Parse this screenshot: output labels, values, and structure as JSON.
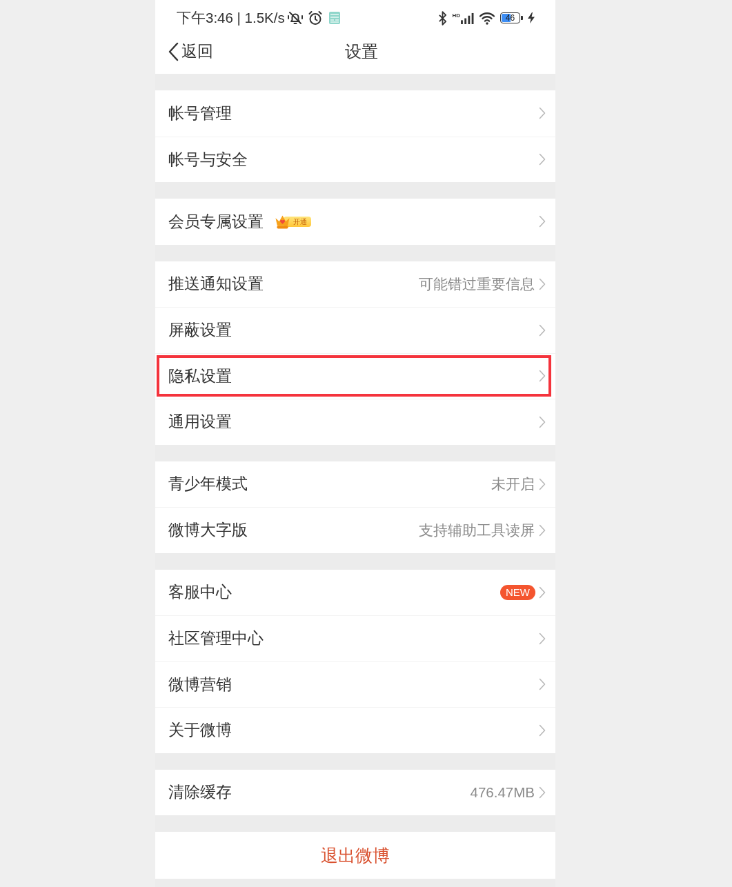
{
  "status_bar": {
    "time_speed": "下午3:46 | 1.5K/s",
    "signal_label": "HD",
    "battery_text": "46"
  },
  "nav_bar": {
    "back": "返回",
    "title": "设置"
  },
  "groups": [
    {
      "items": [
        {
          "label": "帐号管理",
          "highlighted": false
        },
        {
          "label": "帐号与安全",
          "highlighted": false
        }
      ]
    },
    {
      "items": [
        {
          "label": "会员专属设置",
          "badge": {
            "kind": "vip",
            "text": "开通"
          },
          "highlighted": false
        }
      ]
    },
    {
      "items": [
        {
          "label": "推送通知设置",
          "value": "可能错过重要信息",
          "highlighted": false
        },
        {
          "label": "屏蔽设置",
          "highlighted": false
        },
        {
          "label": "隐私设置",
          "highlighted": true
        },
        {
          "label": "通用设置",
          "highlighted": false
        }
      ]
    },
    {
      "items": [
        {
          "label": "青少年模式",
          "value": "未开启",
          "highlighted": false
        },
        {
          "label": "微博大字版",
          "value": "支持辅助工具读屏",
          "highlighted": false
        }
      ]
    },
    {
      "items": [
        {
          "label": "客服中心",
          "badge": {
            "kind": "new",
            "text": "NEW"
          },
          "highlighted": false
        },
        {
          "label": "社区管理中心",
          "highlighted": false
        },
        {
          "label": "微博营销",
          "highlighted": false
        },
        {
          "label": "关于微博",
          "highlighted": false
        }
      ]
    },
    {
      "items": [
        {
          "label": "清除缓存",
          "value": "476.47MB",
          "highlighted": false
        }
      ]
    }
  ],
  "logout": {
    "label": "退出微博"
  }
}
